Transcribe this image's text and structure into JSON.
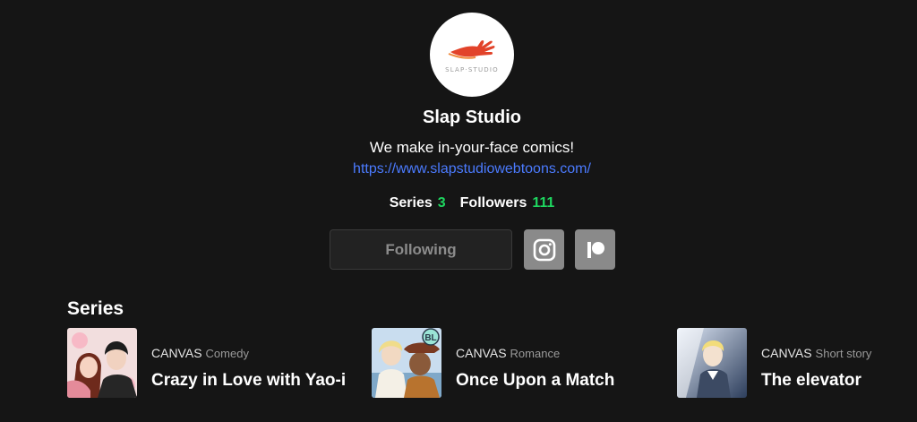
{
  "profile": {
    "logo_text": "SLAP·STUDIO",
    "name": "Slap Studio",
    "tagline": "We make in-your-face comics!",
    "website": "https://www.slapstudiowebtoons.com/",
    "stats": [
      {
        "label": "Series",
        "value": "3"
      },
      {
        "label": "Followers",
        "value": "111"
      }
    ]
  },
  "actions": {
    "follow_label": "Following",
    "social": [
      {
        "name": "instagram-icon"
      },
      {
        "name": "patreon-icon"
      }
    ]
  },
  "series_section": {
    "title": "Series",
    "items": [
      {
        "platform": "CANVAS",
        "genre": "Comedy",
        "title": "Crazy in Love with Yao-i"
      },
      {
        "platform": "CANVAS",
        "genre": "Romance",
        "title": "Once Upon a Match",
        "badge": "BL"
      },
      {
        "platform": "CANVAS",
        "genre": "Short story",
        "title": "The elevator"
      }
    ]
  },
  "colors": {
    "background": "#151515",
    "accent_green": "#1ed760",
    "link_blue": "#4b7bff",
    "logo_red": "#e2432a"
  }
}
